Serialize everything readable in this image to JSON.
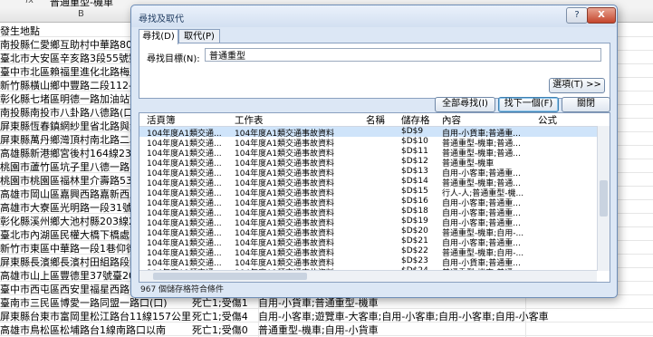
{
  "excel": {
    "formula_value": "普通重型-機車",
    "column_b": "B",
    "column_e": "E",
    "rows": [
      {
        "a": "發生地點",
        "b": "",
        "c": ""
      },
      {
        "a": "南投縣仁愛鄉互助村中華路80號旁",
        "b": "",
        "c": ""
      },
      {
        "a": "臺北市大安區辛亥路3段55號對面",
        "b": "",
        "c": ""
      },
      {
        "a": "臺中市北區賴福里進化北路梅川西",
        "b": "",
        "c": ""
      },
      {
        "a": "新竹縣橫山鄉中豐路二段112-2號合",
        "b": "",
        "c": ""
      },
      {
        "a": "彰化縣七堵區明德一路加油站前15",
        "b": "",
        "c": ""
      },
      {
        "a": "南投縣南投市八卦路八德路(口)139",
        "b": "",
        "c": ""
      },
      {
        "a": "屏東縣恆春鎮網紗里省北路與大埔",
        "b": "",
        "c": ""
      },
      {
        "a": "屏東縣萬丹鄉灣頂村南北路二段9",
        "b": "",
        "c": ""
      },
      {
        "a": "高雄縣新港鄉宮後村164線23公里0",
        "b": "",
        "c": ""
      },
      {
        "a": "桃園市蘆竹區坑子里八德一路39-2",
        "b": "",
        "c": ""
      },
      {
        "a": "桃園市桃園區福林里介壽路531號",
        "b": "",
        "c": ""
      },
      {
        "a": "高雄市岡山區嘉興西路嘉新西路路",
        "b": "",
        "c": ""
      },
      {
        "a": "高雄市大寮區光明路一段31號前",
        "b": "",
        "c": ""
      },
      {
        "a": "彰化縣溪州鄉大池村縣203線27公里",
        "b": "",
        "c": ""
      },
      {
        "a": "臺北市內湖區民權大橋下橋處",
        "b": "",
        "c": ""
      },
      {
        "a": "新竹市東區中華路一段1巷仰德路(",
        "b": "",
        "c": ""
      },
      {
        "a": "屏東縣長濱鄉長濱村田組路段附近",
        "b": "",
        "c": ""
      },
      {
        "a": "高雄市山上區豐德里37號臺20線19",
        "b": "",
        "c": ""
      },
      {
        "a": "臺中市西屯區西安里福星西路四號",
        "b": "",
        "c": "普通重型-機車;自用-小貨車"
      },
      {
        "a": "臺南市三民區博愛一路同盟一路口(口)",
        "b": "死亡1;受傷1",
        "c": "自用-小貨車;普通重型-機車"
      },
      {
        "a": "屏東縣台東市富岡里松江路台11線157公里",
        "b": "死亡1;受傷4",
        "c": "自用-小客車;遊覽車-大客車;自用-小客車;自用-小客車;自用-小客車"
      },
      {
        "a": "高雄市鳥松區松埔路台1線南路口以南",
        "b": "死亡1;受傷0",
        "c": "普通重型-機車;自用-小貨車"
      }
    ]
  },
  "dialog": {
    "title": "尋找及取代",
    "help_icon": "?",
    "close_icon": "X",
    "tabs": [
      {
        "label": "尋找(D)"
      },
      {
        "label": "取代(P)"
      }
    ],
    "find_label": "尋找目標(N):",
    "find_value": "普通重型",
    "options_label": "選項(T) >>",
    "find_all_label": "全部尋找(I)",
    "find_next_label": "找下一個(F)",
    "close_label": "關閉",
    "results": {
      "headers": {
        "book": "活頁簿",
        "sheet": "工作表",
        "name": "名稱",
        "cell": "儲存格",
        "value": "內容",
        "formula": "公式"
      },
      "rows": [
        {
          "book": "104年度A1類交通...",
          "sheet": "104年度A1類交通事故資料",
          "cell": "$D$9",
          "value": "自用-小貨車;普通重..."
        },
        {
          "book": "104年度A1類交通...",
          "sheet": "104年度A1類交通事故資料",
          "cell": "$D$10",
          "value": "普通重型-機車;普通..."
        },
        {
          "book": "104年度A1類交通...",
          "sheet": "104年度A1類交通事故資料",
          "cell": "$D$11",
          "value": "普通重型-機車;普通..."
        },
        {
          "book": "104年度A1類交通...",
          "sheet": "104年度A1類交通事故資料",
          "cell": "$D$12",
          "value": "普通重型-機車"
        },
        {
          "book": "104年度A1類交通...",
          "sheet": "104年度A1類交通事故資料",
          "cell": "$D$13",
          "value": "自用-小客車;普通重..."
        },
        {
          "book": "104年度A1類交通...",
          "sheet": "104年度A1類交通事故資料",
          "cell": "$D$14",
          "value": "普通重型-機車;普通..."
        },
        {
          "book": "104年度A1類交通...",
          "sheet": "104年度A1類交通事故資料",
          "cell": "$D$15",
          "value": "行人-人;普通重型-機..."
        },
        {
          "book": "104年度A1類交通...",
          "sheet": "104年度A1類交通事故資料",
          "cell": "$D$16",
          "value": "自用-小客車;普通重..."
        },
        {
          "book": "104年度A1類交通...",
          "sheet": "104年度A1類交通事故資料",
          "cell": "$D$18",
          "value": "自用-小客車;普通重..."
        },
        {
          "book": "104年度A1類交通...",
          "sheet": "104年度A1類交通事故資料",
          "cell": "$D$19",
          "value": "自用-小客車;普通重..."
        },
        {
          "book": "104年度A1類交通...",
          "sheet": "104年度A1類交通事故資料",
          "cell": "$D$20",
          "value": "普通重型-機車;自用-..."
        },
        {
          "book": "104年度A1類交通...",
          "sheet": "104年度A1類交通事故資料",
          "cell": "$D$21",
          "value": "自用-小客車;普通重..."
        },
        {
          "book": "104年度A1類交通...",
          "sheet": "104年度A1類交通事故資料",
          "cell": "$D$22",
          "value": "普通重型-機車;自用-..."
        },
        {
          "book": "104年度A1類交通...",
          "sheet": "104年度A1類交通事故資料",
          "cell": "$D$23",
          "value": "自用-小貨車;普通重..."
        },
        {
          "book": "104年度A1類交通...",
          "sheet": "104年度A1類交通事故資料",
          "cell": "$D$24",
          "value": "普通重型-機車;普通..."
        }
      ]
    },
    "status": "967 個儲存格符合條件"
  }
}
